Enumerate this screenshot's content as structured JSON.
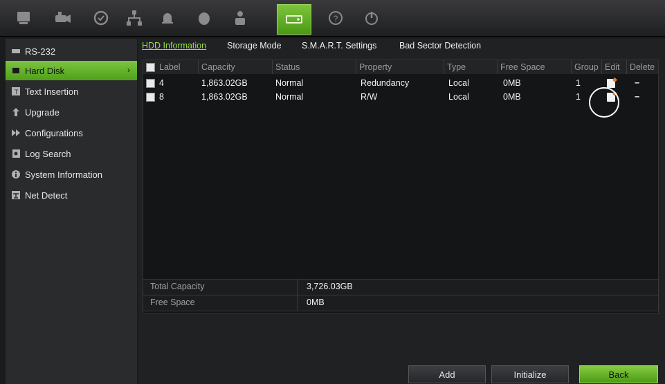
{
  "toolbar": {
    "icons": [
      "monitor-icon",
      "camera-icon",
      "playback-icon",
      "network-icon",
      "alarm-icon",
      "device-icon",
      "user-icon",
      "storage-icon",
      "help-icon",
      "power-icon"
    ],
    "active_index": 7
  },
  "sidebar": {
    "items": [
      {
        "label": "RS-232",
        "icon": "rs232-icon"
      },
      {
        "label": "Hard Disk",
        "icon": "hard-disk-icon"
      },
      {
        "label": "Text Insertion",
        "icon": "text-insertion-icon"
      },
      {
        "label": "Upgrade",
        "icon": "upgrade-icon"
      },
      {
        "label": "Configurations",
        "icon": "configurations-icon"
      },
      {
        "label": "Log Search",
        "icon": "log-search-icon"
      },
      {
        "label": "System Information",
        "icon": "info-icon"
      },
      {
        "label": "Net Detect",
        "icon": "net-detect-icon"
      }
    ],
    "active_label": "Hard Disk",
    "arrow": "›"
  },
  "tabs": [
    "HDD Information",
    "Storage Mode",
    "S.M.A.R.T. Settings",
    "Bad Sector Detection"
  ],
  "table": {
    "headers": [
      "Label",
      "Capacity",
      "Status",
      "Property",
      "Type",
      "Free Space",
      "Group",
      "Edit",
      "Delete"
    ],
    "rows": [
      {
        "label": "4",
        "capacity": "1,863.02GB",
        "status": "Normal",
        "property": "Redundancy",
        "type": "Local",
        "free": "0MB",
        "group": "1",
        "delete": "−"
      },
      {
        "label": "8",
        "capacity": "1,863.02GB",
        "status": "Normal",
        "property": "R/W",
        "type": "Local",
        "free": "0MB",
        "group": "1",
        "delete": "−"
      }
    ]
  },
  "summary": {
    "total_label": "Total Capacity",
    "total_value": "3,726.03GB",
    "free_label": "Free Space",
    "free_value": "0MB"
  },
  "buttons": {
    "add": "Add",
    "initialize": "Initialize",
    "back": "Back"
  },
  "colors": {
    "accent": "#6bbf2a",
    "tab_active": "#9adf44"
  }
}
